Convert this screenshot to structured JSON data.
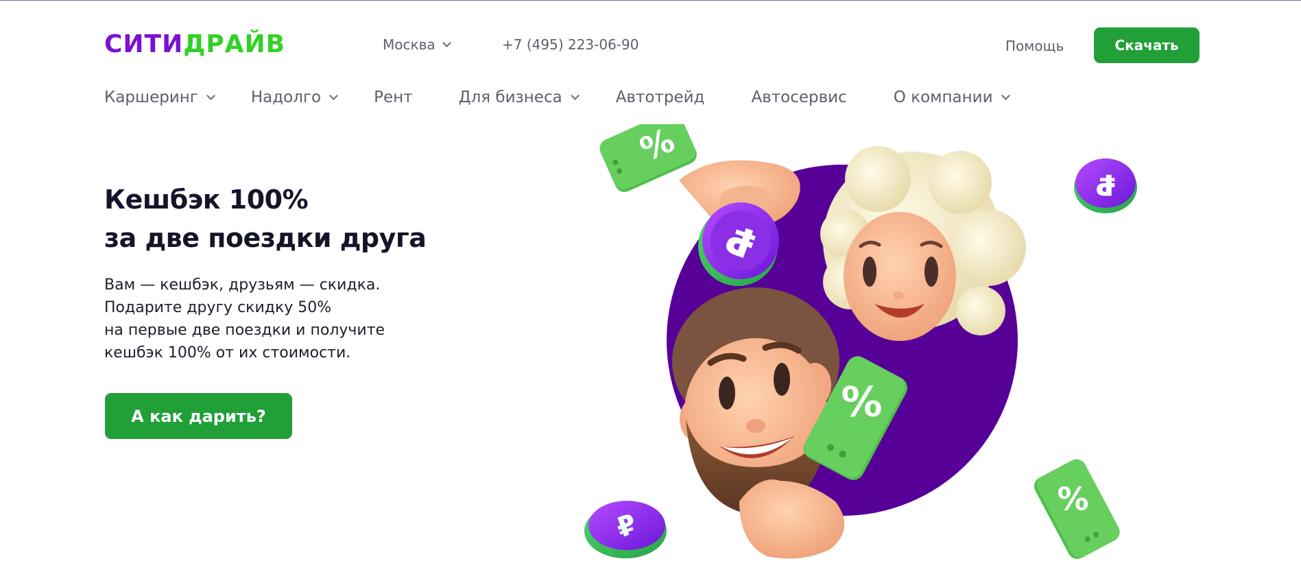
{
  "header": {
    "logo_part1": "СИТИ",
    "logo_part2": "ДРАЙВ",
    "city": "Москва",
    "phone": "+7 (495) 223-06-90",
    "help": "Помощь",
    "download": "Скачать"
  },
  "nav": {
    "items": [
      {
        "label": "Каршеринг",
        "has_dropdown": true
      },
      {
        "label": "Надолго",
        "has_dropdown": true
      },
      {
        "label": "Рент",
        "has_dropdown": false
      },
      {
        "label": "Для бизнеса",
        "has_dropdown": true
      },
      {
        "label": "Автотрейд",
        "has_dropdown": false
      },
      {
        "label": "Автосервис",
        "has_dropdown": false
      },
      {
        "label": "О компании",
        "has_dropdown": true
      }
    ]
  },
  "hero": {
    "title_lines": [
      "Кешбэк 100%",
      "за две поездки друга"
    ],
    "description_lines": [
      "Вам — кешбэк, друзьям — скидка.",
      "Подарите другу скидку 50%",
      "на первые две поездки и получите",
      "кешбэк 100% от их стоимости."
    ],
    "cta": "А как дарить?"
  },
  "art": {
    "coin_symbol": "₽",
    "ticket_symbol": "%"
  },
  "colors": {
    "brand_purple": "#7a12d6",
    "brand_green": "#33d128",
    "button_green": "#21a038",
    "circle_purple": "#560097"
  },
  "icons": [
    "chevron-down-icon",
    "ruble-coin-icon",
    "percent-ticket-icon"
  ]
}
